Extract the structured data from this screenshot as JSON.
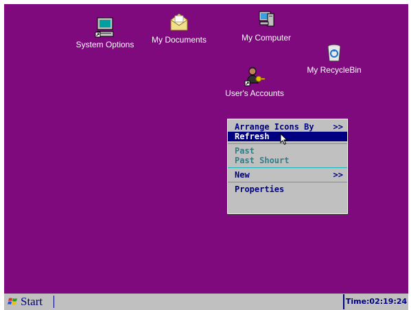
{
  "desktop": {
    "icons": [
      {
        "label": "System Options",
        "icon": "monitor-icon"
      },
      {
        "label": "My Documents",
        "icon": "envelope-icon"
      },
      {
        "label": "My Computer",
        "icon": "computer-icon"
      },
      {
        "label": "My RecycleBin",
        "icon": "recycle-bin-icon"
      },
      {
        "label": "User's Accounts",
        "icon": "users-icon"
      }
    ]
  },
  "context_menu": {
    "arrange": "Arrange Icons By",
    "arrange_arrow": ">>",
    "refresh": "Refresh",
    "paste": "Past",
    "paste_shortcut": "Past Shourt",
    "new": "New",
    "new_arrow": ">>",
    "properties": "Properties"
  },
  "taskbar": {
    "start_label": "Start",
    "clock": "Time:02:19:24"
  },
  "colors": {
    "desktop_bg": "#7e0a7e",
    "menu_bg": "#c0c0c0",
    "menu_text": "#000080",
    "highlight": "#000080",
    "separator": "#18b8b8"
  }
}
